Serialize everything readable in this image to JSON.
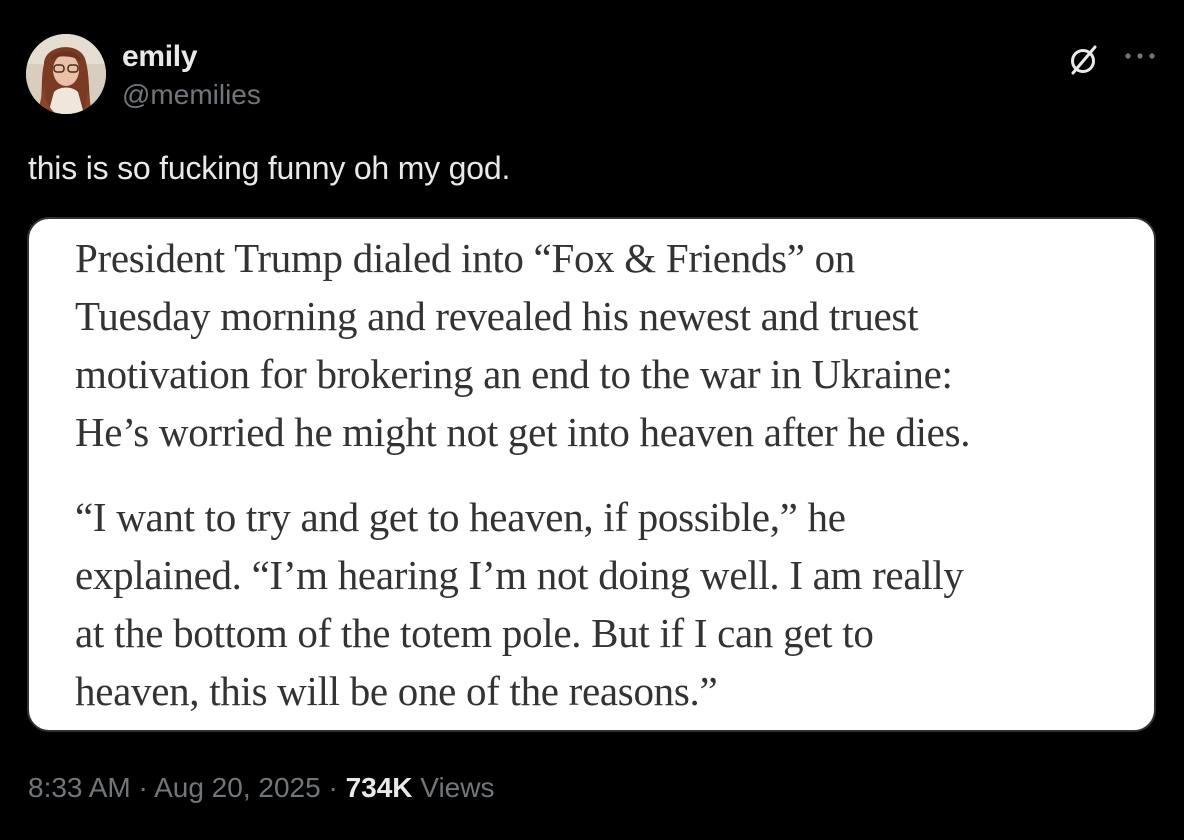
{
  "author": {
    "display_name": "emily",
    "handle": "@memilies",
    "avatar_icon": "profile-photo"
  },
  "header_actions": {
    "grok_icon": "grok-icon",
    "more_icon": "more-options-icon"
  },
  "tweet": {
    "text": "this is so fucking funny oh my god."
  },
  "media": {
    "paragraphs": [
      {
        "lines": [
          "President Trump dialed into “Fox & Friends” on",
          "Tuesday morning and revealed his newest and truest",
          "motivation for brokering an end to the war in Ukraine:",
          "He’s worried he might not get into heaven after he dies."
        ]
      },
      {
        "lines": [
          "“I want to try and get to heaven, if possible,” he",
          "explained. “I’m hearing I’m not doing well. I am really",
          "at the bottom of the totem pole. But if I can get to",
          "heaven, this will be one of the reasons.”"
        ]
      }
    ]
  },
  "meta": {
    "time": "8:33 AM",
    "separator": "·",
    "date": "Aug 20, 2025",
    "views_count": "734K",
    "views_label": "Views"
  },
  "colors": {
    "background": "#000000",
    "primary_text": "#e7e9ea",
    "secondary_text": "#71767b",
    "card_background": "#ffffff",
    "article_text": "#333333"
  }
}
